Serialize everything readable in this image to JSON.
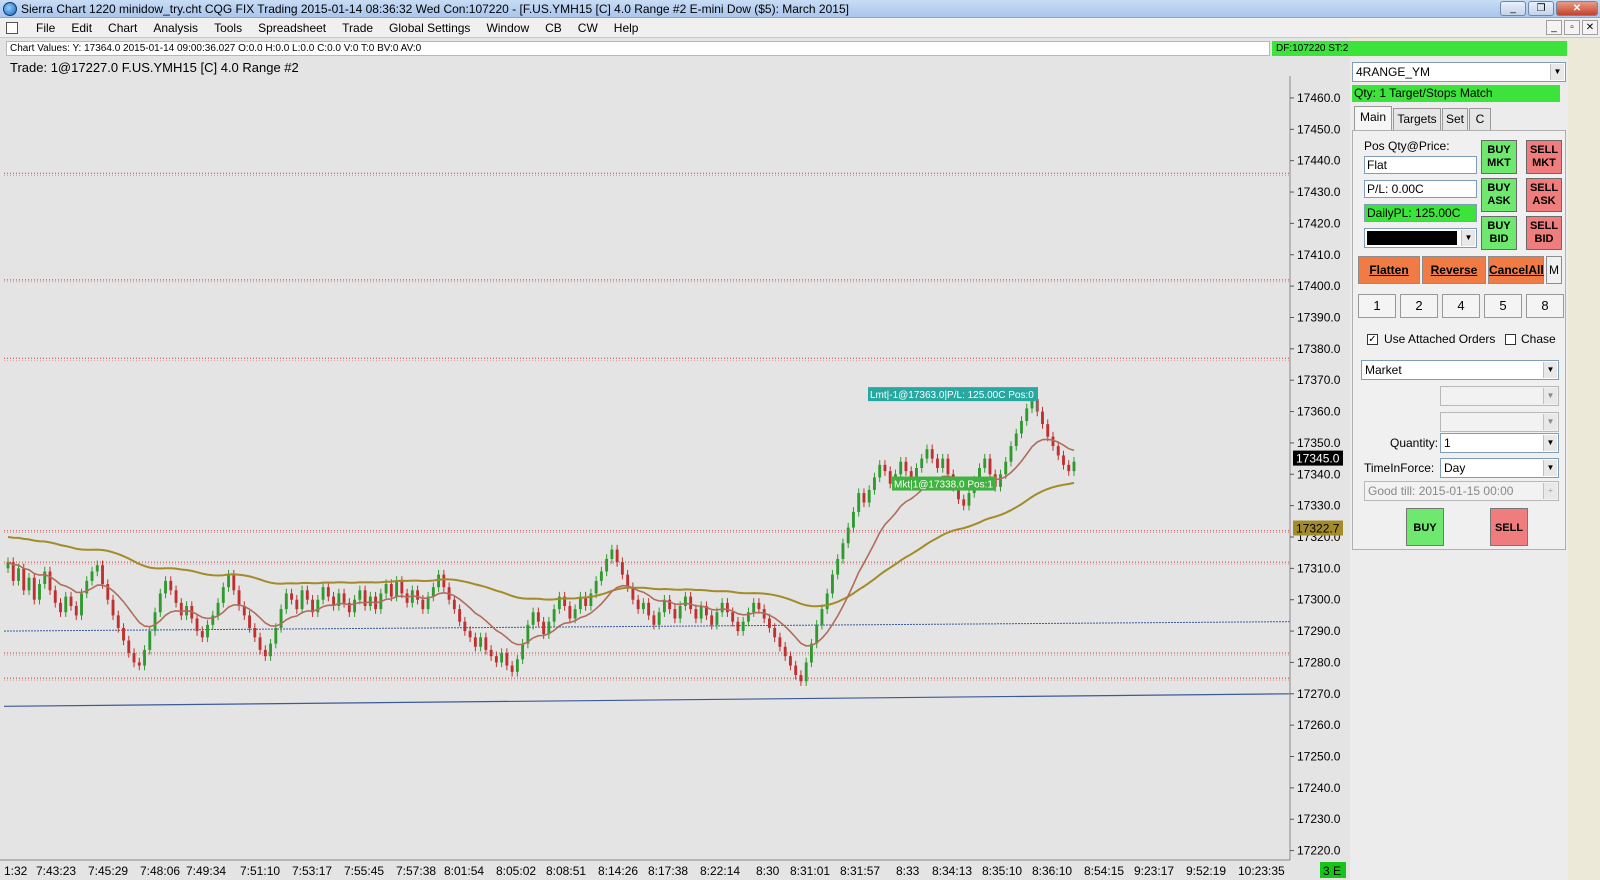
{
  "window": {
    "title": "Sierra Chart 1220 minidow_try.cht  CQG FIX Trading 2015-01-14  08:36:32 Wed  Con:107220 - [F.US.YMH15 [C]  4.0 Range  #2  E-mini Dow ($5): March 2015]",
    "controls": [
      "_",
      "❐",
      "✕"
    ]
  },
  "menu": {
    "items": [
      "File",
      "Edit",
      "Chart",
      "Analysis",
      "Tools",
      "Spreadsheet",
      "Trade",
      "Global Settings",
      "Window",
      "CB",
      "CW",
      "Help"
    ],
    "mdi_controls": [
      "_",
      "▫",
      "✕"
    ]
  },
  "chart": {
    "values_bar": "Chart Values: Y: 17364.0  2015-01-14  09:00:36.027  O:0.0  H:0.0  L:0.0  C:0.0  V:0  T:0  BV:0  AV:0",
    "df_status": "DF:107220  ST:2",
    "trade_label": "Trade:  1@17227.0  F.US.YMH15 [C]  4.0 Range  #2",
    "last_price_label": "17345.0",
    "ma_price_label": "17322.7",
    "status_badge": "3 E",
    "order_labels": {
      "target": "Lmt|-1@17363.0|P/L: 125.00C Pos:0",
      "fill": "Mkt|1@17338.0 Pos:1"
    },
    "colors": {
      "background": "#e4e4e4",
      "up_candle": "#2f9b2f",
      "down_candle": "#c03030",
      "ma_fast": "#b06d5a",
      "ma_slow": "#a38b2a",
      "level_line": "#c04040",
      "blue_line": "#3a5a9a",
      "label_teal": "#27a8a0",
      "label_green": "#3fb23f",
      "last_price_bg": "#000000",
      "ma_price_bg": "#a38b2a"
    }
  },
  "chart_data": {
    "type": "candlestick",
    "y_range": [
      17217,
      17467
    ],
    "y_ticks": [
      17460,
      17450,
      17440,
      17430,
      17420,
      17410,
      17400,
      17390,
      17380,
      17370,
      17360,
      17350,
      17340,
      17330,
      17320,
      17310,
      17300,
      17290,
      17280,
      17270,
      17260,
      17250,
      17240,
      17230,
      17220
    ],
    "x_labels": [
      "1:32",
      "7:43:23",
      "7:45:29",
      "7:48:06",
      "7:49:34",
      "7:51:10",
      "7:53:17",
      "7:55:45",
      "7:57:38",
      "8:01:54",
      "8:05:02",
      "8:08:51",
      "8:14:26",
      "8:17:38",
      "8:22:14",
      "8:30",
      "8:31:01",
      "8:31:57",
      "8:33",
      "8:34:13",
      "8:35:10",
      "8:36:10",
      "8:54:15",
      "9:23:17",
      "9:52:19",
      "10:23:35"
    ],
    "bar_count": 208,
    "closes": [
      17312,
      17306,
      17310,
      17303,
      17307,
      17300,
      17305,
      17309,
      17303,
      17299,
      17296,
      17301,
      17298,
      17295,
      17302,
      17306,
      17309,
      17311,
      17305,
      17300,
      17295,
      17291,
      17287,
      17283,
      17280,
      17279,
      17284,
      17290,
      17296,
      17302,
      17306,
      17303,
      17299,
      17295,
      17298,
      17294,
      17290,
      17288,
      17292,
      17295,
      17299,
      17304,
      17308,
      17303,
      17298,
      17295,
      17291,
      17288,
      17284,
      17282,
      17286,
      17291,
      17297,
      17302,
      17300,
      17297,
      17303,
      17300,
      17296,
      17300,
      17304,
      17301,
      17298,
      17302,
      17299,
      17296,
      17300,
      17303,
      17298,
      17301,
      17297,
      17302,
      17305,
      17301,
      17306,
      17302,
      17299,
      17303,
      17300,
      17297,
      17301,
      17304,
      17308,
      17304,
      17300,
      17297,
      17293,
      17290,
      17288,
      17285,
      17288,
      17284,
      17282,
      17280,
      17283,
      17279,
      17277,
      17281,
      17286,
      17292,
      17296,
      17293,
      17289,
      17293,
      17297,
      17301,
      17298,
      17294,
      17297,
      17301,
      17298,
      17302,
      17306,
      17309,
      17313,
      17316,
      17312,
      17308,
      17304,
      17300,
      17297,
      17299,
      17295,
      17292,
      17296,
      17300,
      17297,
      17294,
      17298,
      17301,
      17297,
      17294,
      17298,
      17295,
      17292,
      17296,
      17299,
      17296,
      17293,
      17290,
      17293,
      17296,
      17299,
      17297,
      17294,
      17291,
      17288,
      17285,
      17282,
      17279,
      17276,
      17274,
      17280,
      17286,
      17292,
      17297,
      17302,
      17308,
      17313,
      17318,
      17323,
      17328,
      17334,
      17331,
      17335,
      17339,
      17343,
      17341,
      17337,
      17340,
      17344,
      17341,
      17338,
      17342,
      17345,
      17348,
      17345,
      17342,
      17345,
      17340,
      17336,
      17332,
      17330,
      17334,
      17338,
      17342,
      17345,
      17340,
      17336,
      17340,
      17344,
      17349,
      17353,
      17357,
      17361,
      17364,
      17360,
      17356,
      17352,
      17349,
      17346,
      17343,
      17341,
      17344
    ],
    "series": [
      {
        "name": "Price",
        "values": "closes"
      }
    ],
    "levels": [
      17436,
      17402,
      17377,
      17322,
      17312,
      17283,
      17275
    ],
    "target_order": 17363,
    "fill_price": 17338,
    "last_price": 17345,
    "ma_value": 17322.7
  },
  "dom": {
    "symbol_select": "4RANGE_YM",
    "status": "Qty: 1 Target/Stops Match",
    "tabs": [
      "Main",
      "Targets",
      "Set",
      "C"
    ],
    "pos_label": "Pos Qty@Price:",
    "pos_value": "Flat",
    "pl_value": "P/L: 0.00C",
    "daily_pl": "DailyPL: 125.00C",
    "buttons": {
      "buy_mkt": "BUY\nMKT",
      "sell_mkt": "SELL\nMKT",
      "buy_ask": "BUY\nASK",
      "sell_ask": "SELL\nASK",
      "buy_bid": "BUY\nBID",
      "sell_bid": "SELL\nBID",
      "flatten": "Flatten",
      "reverse": "Reverse",
      "cancel_all": "CancelAll",
      "m": "M",
      "buy": "BUY",
      "sell": "SELL"
    },
    "qty_buttons": [
      "1",
      "2",
      "4",
      "5",
      "8"
    ],
    "use_attached_label": "Use Attached Orders",
    "chase_label": "Chase",
    "order_type": "Market",
    "quantity_label": "Quantity:",
    "quantity_value": "1",
    "tif_label": "TimeInForce:",
    "tif_value": "Day",
    "good_till": "Good till: 2015-01-15 00:00"
  }
}
